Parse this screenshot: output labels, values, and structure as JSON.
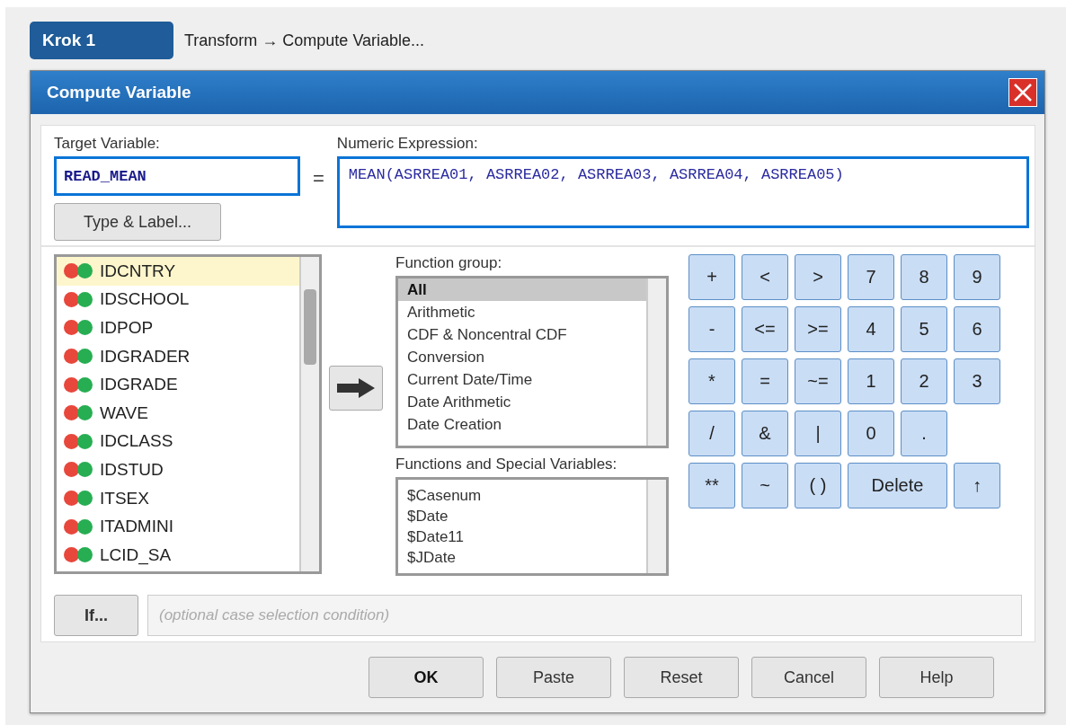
{
  "step": {
    "label": "Krok 1",
    "path": "Transform → Compute Variable..."
  },
  "window": {
    "title": "Compute Variable"
  },
  "target": {
    "label": "Target Variable:",
    "value": "READ_MEAN",
    "button": "Type & Label..."
  },
  "equals": "=",
  "expression": {
    "label": "Numeric Expression:",
    "value": "MEAN(ASRREA01, ASRREA02, ASRREA03, ASRREA04, ASRREA05)"
  },
  "variables": [
    {
      "name": "IDCNTRY",
      "selected": true
    },
    {
      "name": "IDSCHOOL",
      "selected": false
    },
    {
      "name": "IDPOP",
      "selected": false
    },
    {
      "name": "IDGRADER",
      "selected": false
    },
    {
      "name": "IDGRADE",
      "selected": false
    },
    {
      "name": "WAVE",
      "selected": false
    },
    {
      "name": "IDCLASS",
      "selected": false
    },
    {
      "name": "IDSTUD",
      "selected": false
    },
    {
      "name": "ITSEX",
      "selected": false
    },
    {
      "name": "ITADMINI",
      "selected": false
    },
    {
      "name": "LCID_SA",
      "selected": false
    }
  ],
  "function_group": {
    "label": "Function group:",
    "items": [
      {
        "name": "All",
        "selected": true
      },
      {
        "name": "Arithmetic",
        "selected": false
      },
      {
        "name": "CDF & Noncentral CDF",
        "selected": false
      },
      {
        "name": "Conversion",
        "selected": false
      },
      {
        "name": "Current Date/Time",
        "selected": false
      },
      {
        "name": "Date Arithmetic",
        "selected": false
      },
      {
        "name": "Date Creation",
        "selected": false
      }
    ]
  },
  "functions": {
    "label": "Functions and Special Variables:",
    "items": [
      "$Casenum",
      "$Date",
      "$Date11",
      "$JDate"
    ]
  },
  "keypad": [
    [
      {
        "label": "+",
        "wide": false
      },
      {
        "label": "<",
        "wide": false
      },
      {
        "label": ">",
        "wide": false
      },
      {
        "label": "7",
        "wide": false
      },
      {
        "label": "8",
        "wide": false
      },
      {
        "label": "9",
        "wide": false
      }
    ],
    [
      {
        "label": "-",
        "wide": false
      },
      {
        "label": "<=",
        "wide": false
      },
      {
        "label": ">=",
        "wide": false
      },
      {
        "label": "4",
        "wide": false
      },
      {
        "label": "5",
        "wide": false
      },
      {
        "label": "6",
        "wide": false
      }
    ],
    [
      {
        "label": "*",
        "wide": false
      },
      {
        "label": "=",
        "wide": false
      },
      {
        "label": "~=",
        "wide": false
      },
      {
        "label": "1",
        "wide": false
      },
      {
        "label": "2",
        "wide": false
      },
      {
        "label": "3",
        "wide": false
      }
    ],
    [
      {
        "label": "/",
        "wide": false
      },
      {
        "label": "&",
        "wide": false
      },
      {
        "label": "|",
        "wide": false
      },
      {
        "label": "0",
        "wide": false
      },
      {
        "label": ".",
        "wide": false
      }
    ],
    [
      {
        "label": "**",
        "wide": false
      },
      {
        "label": "~",
        "wide": false
      },
      {
        "label": "( )",
        "wide": false
      },
      {
        "label": "Delete",
        "wide": true
      },
      {
        "label": "↑",
        "wide": false
      }
    ]
  ],
  "condition": {
    "button": "If...",
    "placeholder": "(optional case selection condition)"
  },
  "buttons": [
    {
      "label": "OK",
      "default": true
    },
    {
      "label": "Paste",
      "default": false
    },
    {
      "label": "Reset",
      "default": false
    },
    {
      "label": "Cancel",
      "default": false
    },
    {
      "label": "Help",
      "default": false
    }
  ]
}
